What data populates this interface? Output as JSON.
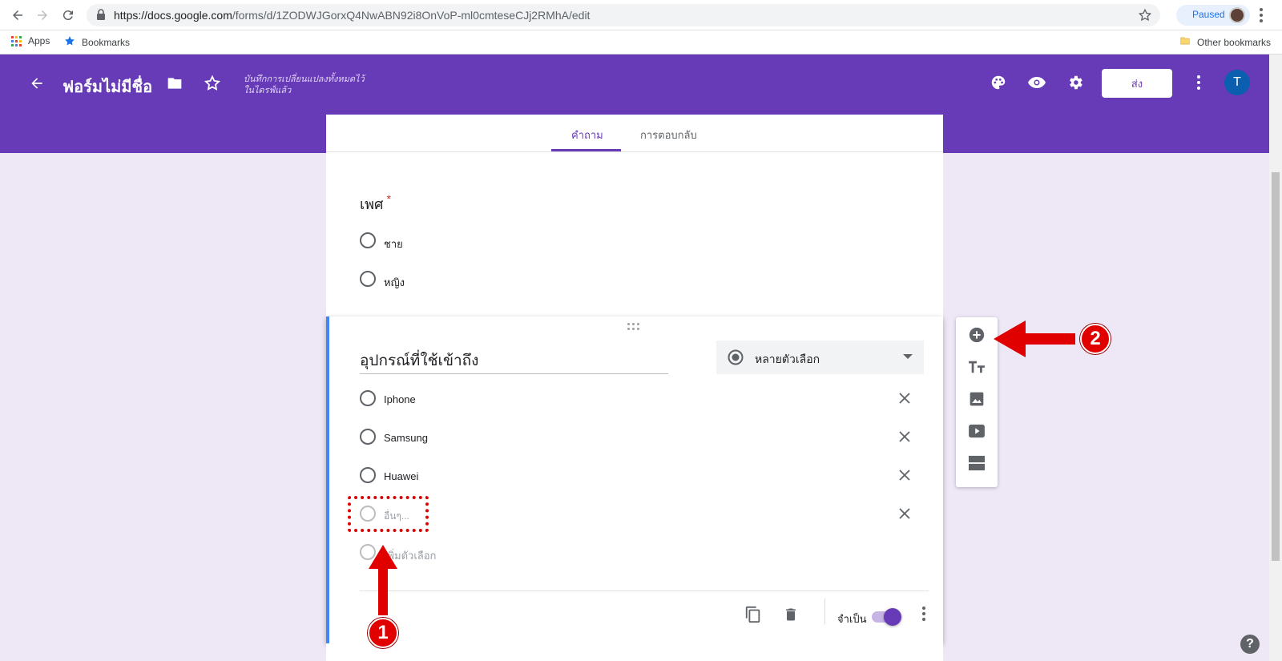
{
  "browser": {
    "url_domain": "https://docs.google.com",
    "url_path": "/forms/d/1ZODWJGorxQ4NwABN92i8OnVoP-ml0cmteseCJj2RMhA/edit",
    "paused_label": "Paused",
    "bookmarks": {
      "apps_label": "Apps",
      "bookmarks_label": "Bookmarks",
      "other_label": "Other bookmarks"
    }
  },
  "header": {
    "form_title": "ฟอร์มไม่มีชื่อ",
    "saved_line1": "บันทึกการเปลี่ยนแปลงทั้งหมดไว้",
    "saved_line2": "ในไดรฟ์แล้ว",
    "send_label": "ส่ง",
    "avatar_letter": "T",
    "accent_color": "#673ab7"
  },
  "tabs": {
    "questions": "คำถาม",
    "responses": "การตอบกลับ"
  },
  "question1": {
    "title": "เพศ",
    "required_mark": "*",
    "options": [
      "ชาย",
      "หญิง"
    ]
  },
  "question2": {
    "title": "อุปกรณ์ที่ใช้เข้าถึง",
    "type_label": "หลายตัวเลือก",
    "options": [
      "Iphone",
      "Samsung",
      "Huawei"
    ],
    "other_placeholder": "อื่นๆ...",
    "add_option": "เพิ่มตัวเลือก",
    "required_label": "จำเป็น",
    "required_on": true
  },
  "annotations": {
    "badge1": "1",
    "badge2": "2",
    "color": "#e00000"
  },
  "help": "?"
}
